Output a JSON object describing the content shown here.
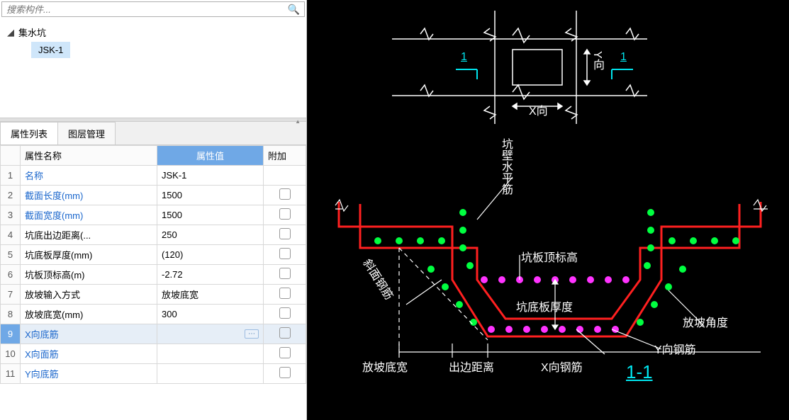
{
  "search": {
    "placeholder": "搜索构件..."
  },
  "tree": {
    "root_label": "集水坑",
    "child_label": "JSK-1"
  },
  "tabs": {
    "properties": "属性列表",
    "layers": "图层管理"
  },
  "grid": {
    "headers": {
      "name": "属性名称",
      "value": "属性值",
      "extra": "附加"
    },
    "rows": [
      {
        "idx": "1",
        "name": "名称",
        "value": "JSK-1",
        "link": true
      },
      {
        "idx": "2",
        "name": "截面长度(mm)",
        "value": "1500",
        "link": true
      },
      {
        "idx": "3",
        "name": "截面宽度(mm)",
        "value": "1500",
        "link": true
      },
      {
        "idx": "4",
        "name": "坑底出边距离(...",
        "value": "250",
        "link": false
      },
      {
        "idx": "5",
        "name": "坑底板厚度(mm)",
        "value": "(120)",
        "link": false
      },
      {
        "idx": "6",
        "name": "坑板顶标高(m)",
        "value": "-2.72",
        "link": false
      },
      {
        "idx": "7",
        "name": "放坡输入方式",
        "value": "放坡底宽",
        "link": false
      },
      {
        "idx": "8",
        "name": "放坡底宽(mm)",
        "value": "300",
        "link": false
      },
      {
        "idx": "9",
        "name": "X向底筋",
        "value": "",
        "link": true,
        "selected": true,
        "ellipsis": true
      },
      {
        "idx": "10",
        "name": "X向面筋",
        "value": "",
        "link": true
      },
      {
        "idx": "11",
        "name": "Y向底筋",
        "value": "",
        "link": true
      }
    ]
  },
  "diagram": {
    "plan": {
      "x_label": "X向",
      "y_label": "Y向",
      "section_mark": "1"
    },
    "section": {
      "labels": {
        "kbsp": "坑壁水平筋",
        "kbdg": "坑板顶标高",
        "kdbh": "坑底板厚度",
        "xmgj": "斜面钢筋",
        "fpdk": "放坡底宽",
        "cbjl": "出边距离",
        "xgj": "X向钢筋",
        "ygj": "Y向钢筋",
        "fpjd": "放坡角度",
        "title": "1-1"
      }
    }
  }
}
